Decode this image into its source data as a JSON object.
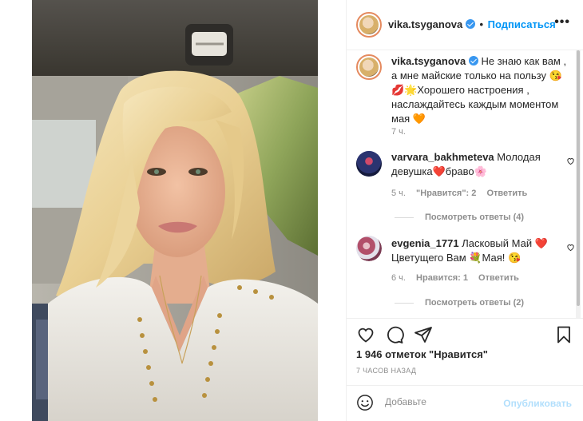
{
  "header": {
    "username": "vika.tsyganova",
    "follow_label": "Подписаться",
    "separator": "•",
    "more_label": "•••"
  },
  "caption": {
    "username": "vika.tsyganova",
    "text": "Не знаю как вам , а мне майские только на пользу 😘💋🌟Хорошего настроения , наслаждайтесь каждым моментом мая 🧡",
    "time": "7 ч."
  },
  "comments": [
    {
      "username": "varvara_bakhmeteva",
      "text": "Молодая девушка❤️браво🌸",
      "time": "5 ч.",
      "likes": "\"Нравится\": 2",
      "reply_label": "Ответить",
      "view_replies": "Посмотреть ответы (4)"
    },
    {
      "username": "evgenia_1771",
      "text": "Ласковый Май ❤️Цветущего Вам 💐Мая! 😘",
      "time": "6 ч.",
      "likes": "Нравится: 1",
      "reply_label": "Ответить",
      "view_replies": "Посмотреть ответы (2)"
    }
  ],
  "icons": {
    "like": "heart-outline",
    "comment": "speech-bubble",
    "share": "paper-plane",
    "save": "bookmark"
  },
  "likes_count": "1 946 отметок \"Нравится\"",
  "timestamp": "7 ЧАСОВ НАЗАД",
  "add_comment": {
    "placeholder": "Добавьте",
    "publish_label": "Опубликовать"
  },
  "colors": {
    "follow": "#0095f6",
    "publish_disabled": "#b2dffc",
    "verified": "#3897f0"
  }
}
